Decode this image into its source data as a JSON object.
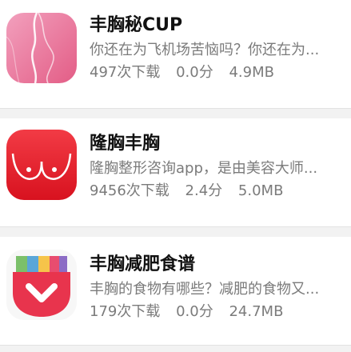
{
  "apps": [
    {
      "name": "丰胸秘CUP",
      "description": "你还在为飞机场苦恼吗？你还在为...",
      "downloads": "497次下载",
      "rating": "0.0分",
      "size": "4.9MB",
      "icon": "pink-silhouette-icon"
    },
    {
      "name": "隆胸丰胸",
      "description": "隆胸整形咨询app，是由美容大师...",
      "downloads": "9456次下载",
      "rating": "2.4分",
      "size": "5.0MB",
      "icon": "red-chest-icon"
    },
    {
      "name": "丰胸减肥食谱",
      "description": "丰胸的食物有哪些？减肥的食物又...",
      "downloads": "179次下载",
      "rating": "0.0分",
      "size": "24.7MB",
      "icon": "pocket-chevron-icon"
    }
  ]
}
